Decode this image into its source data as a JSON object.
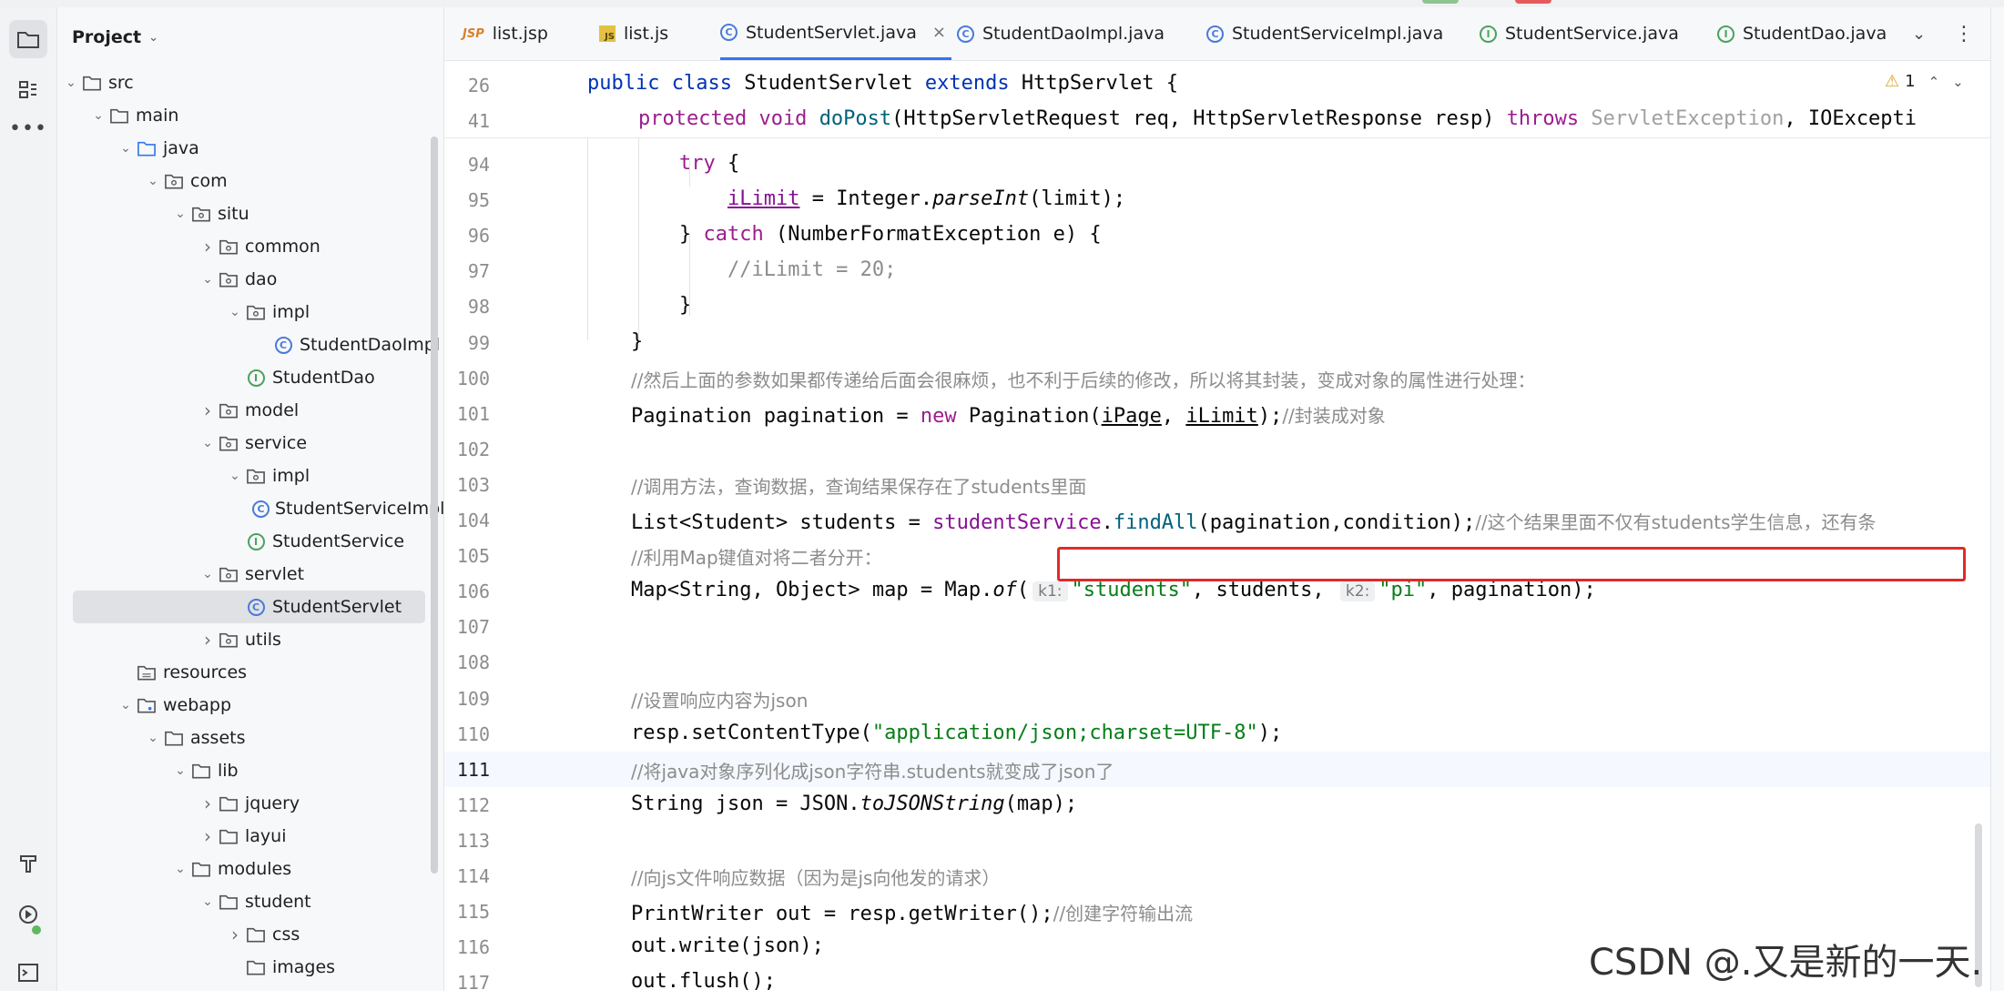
{
  "project_panel": {
    "title": "Project",
    "tree": [
      {
        "label": "src",
        "depth": 0,
        "type": "folder",
        "expanded": true
      },
      {
        "label": "main",
        "depth": 1,
        "type": "folder",
        "expanded": true
      },
      {
        "label": "java",
        "depth": 2,
        "type": "folder-source",
        "expanded": true
      },
      {
        "label": "com",
        "depth": 3,
        "type": "package",
        "expanded": true
      },
      {
        "label": "situ",
        "depth": 4,
        "type": "package",
        "expanded": true
      },
      {
        "label": "common",
        "depth": 5,
        "type": "package",
        "expanded": false
      },
      {
        "label": "dao",
        "depth": 5,
        "type": "package",
        "expanded": true
      },
      {
        "label": "impl",
        "depth": 6,
        "type": "package",
        "expanded": true
      },
      {
        "label": "StudentDaoImpl",
        "depth": 7,
        "type": "class"
      },
      {
        "label": "StudentDao",
        "depth": 6,
        "type": "interface"
      },
      {
        "label": "model",
        "depth": 5,
        "type": "package",
        "expanded": false
      },
      {
        "label": "service",
        "depth": 5,
        "type": "package",
        "expanded": true
      },
      {
        "label": "impl",
        "depth": 6,
        "type": "package",
        "expanded": true
      },
      {
        "label": "StudentServiceImpl",
        "depth": 7,
        "type": "class"
      },
      {
        "label": "StudentService",
        "depth": 6,
        "type": "interface"
      },
      {
        "label": "servlet",
        "depth": 5,
        "type": "package",
        "expanded": true
      },
      {
        "label": "StudentServlet",
        "depth": 6,
        "type": "class",
        "selected": true
      },
      {
        "label": "utils",
        "depth": 5,
        "type": "package",
        "expanded": false
      },
      {
        "label": "resources",
        "depth": 2,
        "type": "folder-res"
      },
      {
        "label": "webapp",
        "depth": 2,
        "type": "folder-web",
        "expanded": true
      },
      {
        "label": "assets",
        "depth": 3,
        "type": "folder",
        "expanded": true
      },
      {
        "label": "lib",
        "depth": 4,
        "type": "folder",
        "expanded": true
      },
      {
        "label": "jquery",
        "depth": 5,
        "type": "folder",
        "expanded": false
      },
      {
        "label": "layui",
        "depth": 5,
        "type": "folder",
        "expanded": false
      },
      {
        "label": "modules",
        "depth": 4,
        "type": "folder",
        "expanded": true
      },
      {
        "label": "student",
        "depth": 5,
        "type": "folder",
        "expanded": true
      },
      {
        "label": "css",
        "depth": 6,
        "type": "folder",
        "expanded": false
      },
      {
        "label": "images",
        "depth": 6,
        "type": "folder"
      }
    ]
  },
  "tabs": [
    {
      "label": "list.jsp",
      "icon": "jsp-icon"
    },
    {
      "label": "list.js",
      "icon": "js-icon"
    },
    {
      "label": "StudentServlet.java",
      "icon": "class-icon",
      "active": true
    },
    {
      "label": "StudentDaoImpl.java",
      "icon": "class-icon"
    },
    {
      "label": "StudentServiceImpl.java",
      "icon": "class-icon"
    },
    {
      "label": "StudentService.java",
      "icon": "interface-icon"
    },
    {
      "label": "StudentDao.java",
      "icon": "interface-icon"
    }
  ],
  "editor": {
    "warning_count": "1",
    "sticky_lines": [
      {
        "num": "26",
        "text": "public class StudentServlet extends HttpServlet {"
      },
      {
        "num": "41",
        "text": "protected void doPost(HttpServletRequest req, HttpServletResponse resp) throws ServletException, IOExcepti"
      }
    ],
    "lines": {
      "l94": {
        "num": "94"
      },
      "l95": {
        "num": "95"
      },
      "l96": {
        "num": "96"
      },
      "l97": {
        "num": "97",
        "comment": "//iLimit = 20;"
      },
      "l98": {
        "num": "98"
      },
      "l99": {
        "num": "99"
      },
      "l100": {
        "num": "100",
        "comment": "//然后上面的参数如果都传递给后面会很麻烦，也不利于后续的修改，所以将其封装，变成对象的属性进行处理："
      },
      "l101": {
        "num": "101",
        "comment": "//封装成对象"
      },
      "l102": {
        "num": "102"
      },
      "l103": {
        "num": "103",
        "comment": "//调用方法，查询数据，查询结果保存在了students里面"
      },
      "l104": {
        "num": "104",
        "comment": "//这个结果里面不仅有students学生信息，还有条"
      },
      "l105": {
        "num": "105",
        "comment": "//利用Map键值对将二者分开："
      },
      "l106": {
        "num": "106",
        "hint1": "k1:",
        "str1": "\"students\"",
        "hint2": "k2:",
        "str2": "\"pi\""
      },
      "l107": {
        "num": "107"
      },
      "l108": {
        "num": "108"
      },
      "l109": {
        "num": "109",
        "comment": "//设置响应内容为json"
      },
      "l110": {
        "num": "110",
        "str": "\"application/json;charset=UTF-8\""
      },
      "l111": {
        "num": "111",
        "comment": "//将java对象序列化成json字符串.students就变成了json了"
      },
      "l112": {
        "num": "112"
      },
      "l113": {
        "num": "113"
      },
      "l114": {
        "num": "114",
        "comment": "//向js文件响应数据（因为是js向他发的请求）"
      },
      "l115": {
        "num": "115",
        "comment": "//创建字符输出流"
      },
      "l116": {
        "num": "116"
      },
      "l117": {
        "num": "117"
      }
    }
  },
  "watermark": "CSDN @.又是新的一天.",
  "colors": {
    "accent": "#3574f0",
    "highlight_box": "#e02a2a",
    "keyword": "#0033b3",
    "string": "#067d17"
  }
}
